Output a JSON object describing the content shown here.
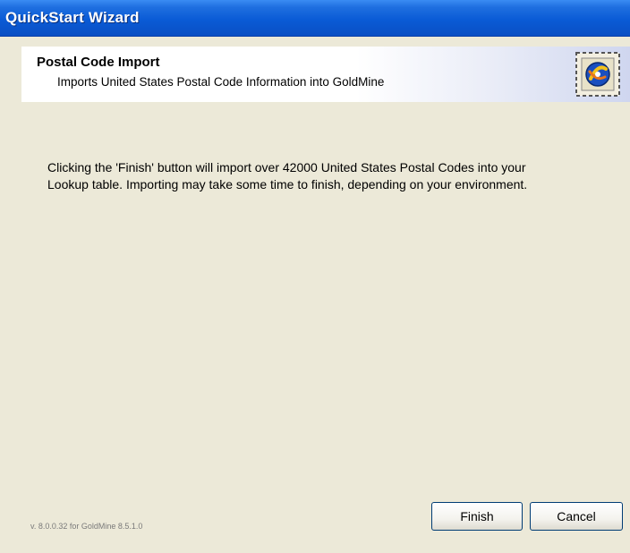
{
  "window": {
    "title": "QuickStart Wizard"
  },
  "header": {
    "title": "Postal Code Import",
    "subtitle": "Imports United States Postal Code Information into GoldMine",
    "icon": "goldmine-stamp-icon"
  },
  "body": {
    "message_line1": "Clicking the 'Finish' button will import over 42000 United States Postal Codes into your",
    "message_line2": "Lookup table. Importing may take some time to finish, depending on your environment."
  },
  "footer": {
    "version": "v. 8.0.0.32 for GoldMine 8.5.1.0",
    "finish_label": "Finish",
    "cancel_label": "Cancel"
  },
  "colors": {
    "titlebar": "#0a5bd6",
    "dialog_bg": "#ece9d8",
    "button_border": "#003c74"
  }
}
